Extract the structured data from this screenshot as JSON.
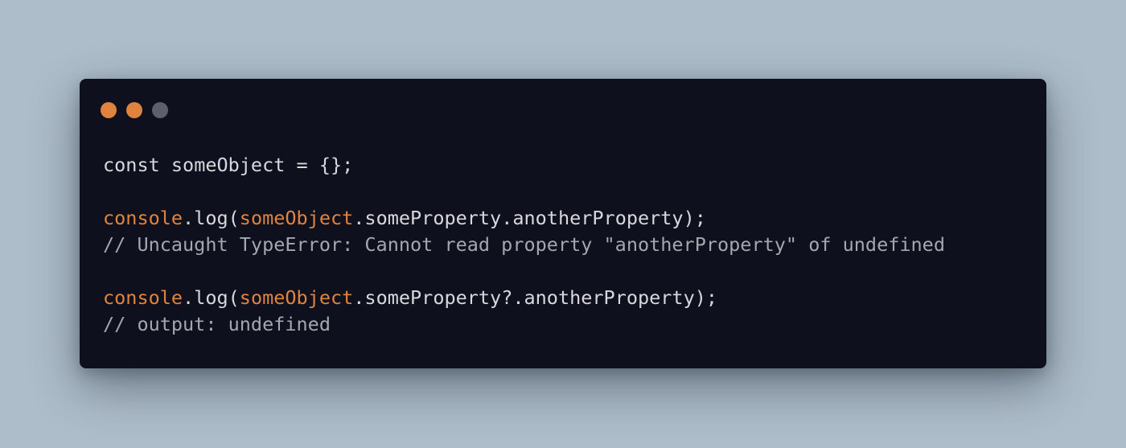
{
  "colors": {
    "page_background": "#aebdca",
    "window_background": "#0e111d",
    "accent": "#e0833f",
    "text": "#d8d8dc",
    "comment": "#a4a7ad"
  },
  "window_controls": [
    {
      "name": "close",
      "color": "#e0833f"
    },
    {
      "name": "minimize",
      "color": "#e0833f"
    },
    {
      "name": "maximize",
      "color": "#5c6068"
    }
  ],
  "code": {
    "lines": [
      {
        "tokens": [
          {
            "text": "const",
            "type": "keyword"
          },
          {
            "text": " someObject = {};",
            "type": "plain"
          }
        ]
      },
      {
        "tokens": []
      },
      {
        "tokens": [
          {
            "text": "console",
            "type": "accent"
          },
          {
            "text": ".log(",
            "type": "plain"
          },
          {
            "text": "someObject",
            "type": "accent"
          },
          {
            "text": ".someProperty.anotherProperty);",
            "type": "plain"
          }
        ]
      },
      {
        "tokens": [
          {
            "text": "// Uncaught TypeError: Cannot read property \"anotherProperty\" of undefined",
            "type": "comment"
          }
        ]
      },
      {
        "tokens": []
      },
      {
        "tokens": [
          {
            "text": "console",
            "type": "accent"
          },
          {
            "text": ".log(",
            "type": "plain"
          },
          {
            "text": "someObject",
            "type": "accent"
          },
          {
            "text": ".someProperty?.anotherProperty);",
            "type": "plain"
          }
        ]
      },
      {
        "tokens": [
          {
            "text": "// output: undefined",
            "type": "comment"
          }
        ]
      }
    ]
  }
}
